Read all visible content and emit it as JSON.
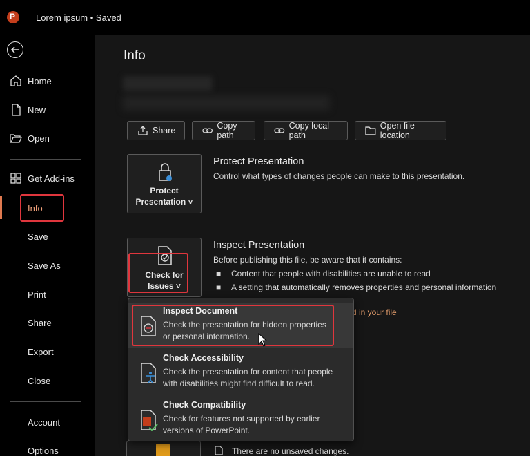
{
  "window": {
    "title": "Lorem ipsum • Saved"
  },
  "sidebar": {
    "items": [
      {
        "label": "Home",
        "icon": "home-icon"
      },
      {
        "label": "New",
        "icon": "new-document-icon"
      },
      {
        "label": "Open",
        "icon": "folder-open-icon"
      },
      {
        "label": "Get Add-ins",
        "icon": "add-ins-icon"
      },
      {
        "label": "Info",
        "active": true
      },
      {
        "label": "Save"
      },
      {
        "label": "Save As"
      },
      {
        "label": "Print"
      },
      {
        "label": "Share"
      },
      {
        "label": "Export"
      },
      {
        "label": "Close"
      },
      {
        "label": "Account"
      },
      {
        "label": "Options"
      }
    ]
  },
  "main": {
    "title": "Info",
    "toolbar": [
      {
        "label": "Share",
        "icon": "share-icon"
      },
      {
        "label": "Copy path",
        "icon": "link-icon"
      },
      {
        "label": "Copy local path",
        "icon": "link-icon"
      },
      {
        "label": "Open file location",
        "icon": "folder-icon"
      }
    ],
    "protect": {
      "tile_line1": "Protect",
      "tile_line2": "Presentation ˅",
      "heading": "Protect Presentation",
      "description": "Control what types of changes people can make to this presentation."
    },
    "inspect": {
      "tile_line1": "Check for",
      "tile_line2": "Issues ˅",
      "heading": "Inspect Presentation",
      "description": "Before publishing this file, be aware that it contains:",
      "bullets": [
        "Content that people with disabilities are unable to read",
        "A setting that automatically removes properties and personal information"
      ],
      "link_fragment": "d in your file"
    },
    "versions": {
      "text": "There are no unsaved changes."
    }
  },
  "dropdown": {
    "items": [
      {
        "title": "Inspect Document",
        "desc1": "Check the presentation for hidden properties",
        "desc2": "or personal information.",
        "icon": "inspect-document-icon"
      },
      {
        "title": "Check Accessibility",
        "desc1": "Check the presentation for content that people",
        "desc2": "with disabilities might find difficult to read.",
        "icon": "accessibility-icon"
      },
      {
        "title": "Check Compatibility",
        "desc1": "Check for features not supported by earlier",
        "desc2": "versions of PowerPoint.",
        "icon": "compatibility-icon"
      }
    ]
  },
  "colors": {
    "accent": "#e07a50",
    "highlight": "#e0363d",
    "background": "#161616"
  }
}
